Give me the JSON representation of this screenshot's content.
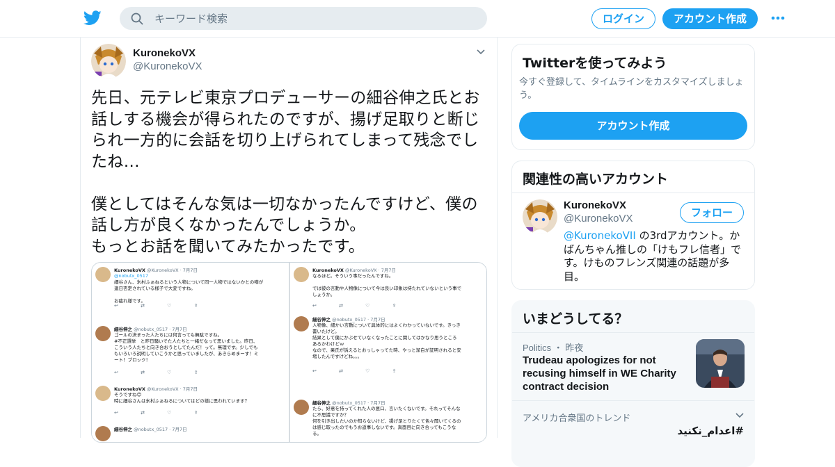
{
  "colors": {
    "accent": "#1da1f2",
    "text": "#14171a",
    "secondary": "#657786",
    "border": "#e6ecf0"
  },
  "header": {
    "search_placeholder": "キーワード検索",
    "login_label": "ログイン",
    "signup_label": "アカウント作成"
  },
  "tweet": {
    "display_name": "KuronekoVX",
    "handle": "@KuronekoVX",
    "text": "先日、元テレビ東京プロデューサーの細谷伸之氏とお話しする機会が得られたのですが、揚げ足取りと断じられ一方的に会話を切り上げられてしまって残念でしたね…\n\n僕としてはそんな気は一切なかったんですけど、僕の話し方が良くなかったんでしょうか。\nもっとお話を聞いてみたかったです。",
    "media": {
      "left": [
        {
          "name": "KuronekoVX",
          "meta": "@KuronekoVX · 7月7日",
          "reply_to": "@nobutx_0517",
          "body": "細谷さん、氷村ふぁねるという人物について同一人物ではないかとの噂が\n連日否定されている様子で大変ですね。\n\nお疲れ様です。"
        },
        {
          "name": "細谷伸之",
          "meta": "@nobutx_0517 · 7月7日",
          "body": "ゴールの決まった人たちには何言っても無駄ですね。\n#不正選挙　と昨日騒いでた人たちと一緒だなって思いました。昨日、\nこういう人たちと向き合おうとしてたんだ！って。無理です。少しでも\nもいろいろ説明していこうかと思っていましたが、あきらめまーす！ミ\nート！ブロック！"
        },
        {
          "name": "KuronekoVX",
          "meta": "@KuronekoVX · 7月7日",
          "body": "そうですね😊\n時に細谷さんは氷村ふぁねるについてはどの様に思われています？"
        },
        {
          "name": "細谷伸之",
          "meta": "@nobutx_0517 · 7月7日",
          "body": ""
        }
      ],
      "right": [
        {
          "name": "KuronekoVX",
          "meta": "@KuronekoVX · 7月7日",
          "body": "なるほど。そういう事だったんですね。\n\nでは彼の言動や人物像について今は良い印象は持たれていないという事で\nしょうか。"
        },
        {
          "name": "細谷伸之",
          "meta": "@nobutx_0517 · 7月7日",
          "body": "人物像、細かい言動について具体的にはよくわかっていないです。きっき\n書いたけど。\n結果として僕にかぶせていなくなったことに関してはかなり思うところ\nあるかわけどｗ\nなので、果氏が訴えるとおっしゃってた時、やっと潔白が証明されると安\n堵したんですけどね。。。"
        },
        {
          "name": "細谷伸之",
          "meta": "@nobutx_0517 · 7月7日",
          "body": "たら、好意を持ってくれた人の悪口、言いたくないです。それってそんな\nに不思議ですか？\n何を引き出したいのか知らないけど、揚げ足とりたくて色々聞いてくるの\nは感じ取ったのでもうお返事しないです。真面目に向き合ってもこうな\nる。"
        }
      ]
    }
  },
  "sidebar": {
    "signup_card": {
      "title": "Twitterを使ってみよう",
      "subtitle": "今すぐ登録して、タイムラインをカスタマイズしましょう。",
      "button": "アカウント作成"
    },
    "related": {
      "title": "関連性の高いアカウント",
      "name": "KuronekoVX",
      "handle": "@KuronekoVX",
      "follow_label": "フォロー",
      "bio_link": "@KuronekoVII",
      "bio_text": " の3rdアカウント。かばんちゃん推しの「けもフレ信者」です。けものフレンズ関連の話題が多目。"
    },
    "trends": {
      "title": "いまどうしてる？",
      "news_category": "Politics",
      "news_time": "昨夜",
      "news_headline": "Trudeau apologizes for not recusing himself in WE Charity contract decision",
      "trend_header": "アメリカ合衆国のトレンド",
      "trend_1": "#اعدام_نكنيد"
    }
  }
}
